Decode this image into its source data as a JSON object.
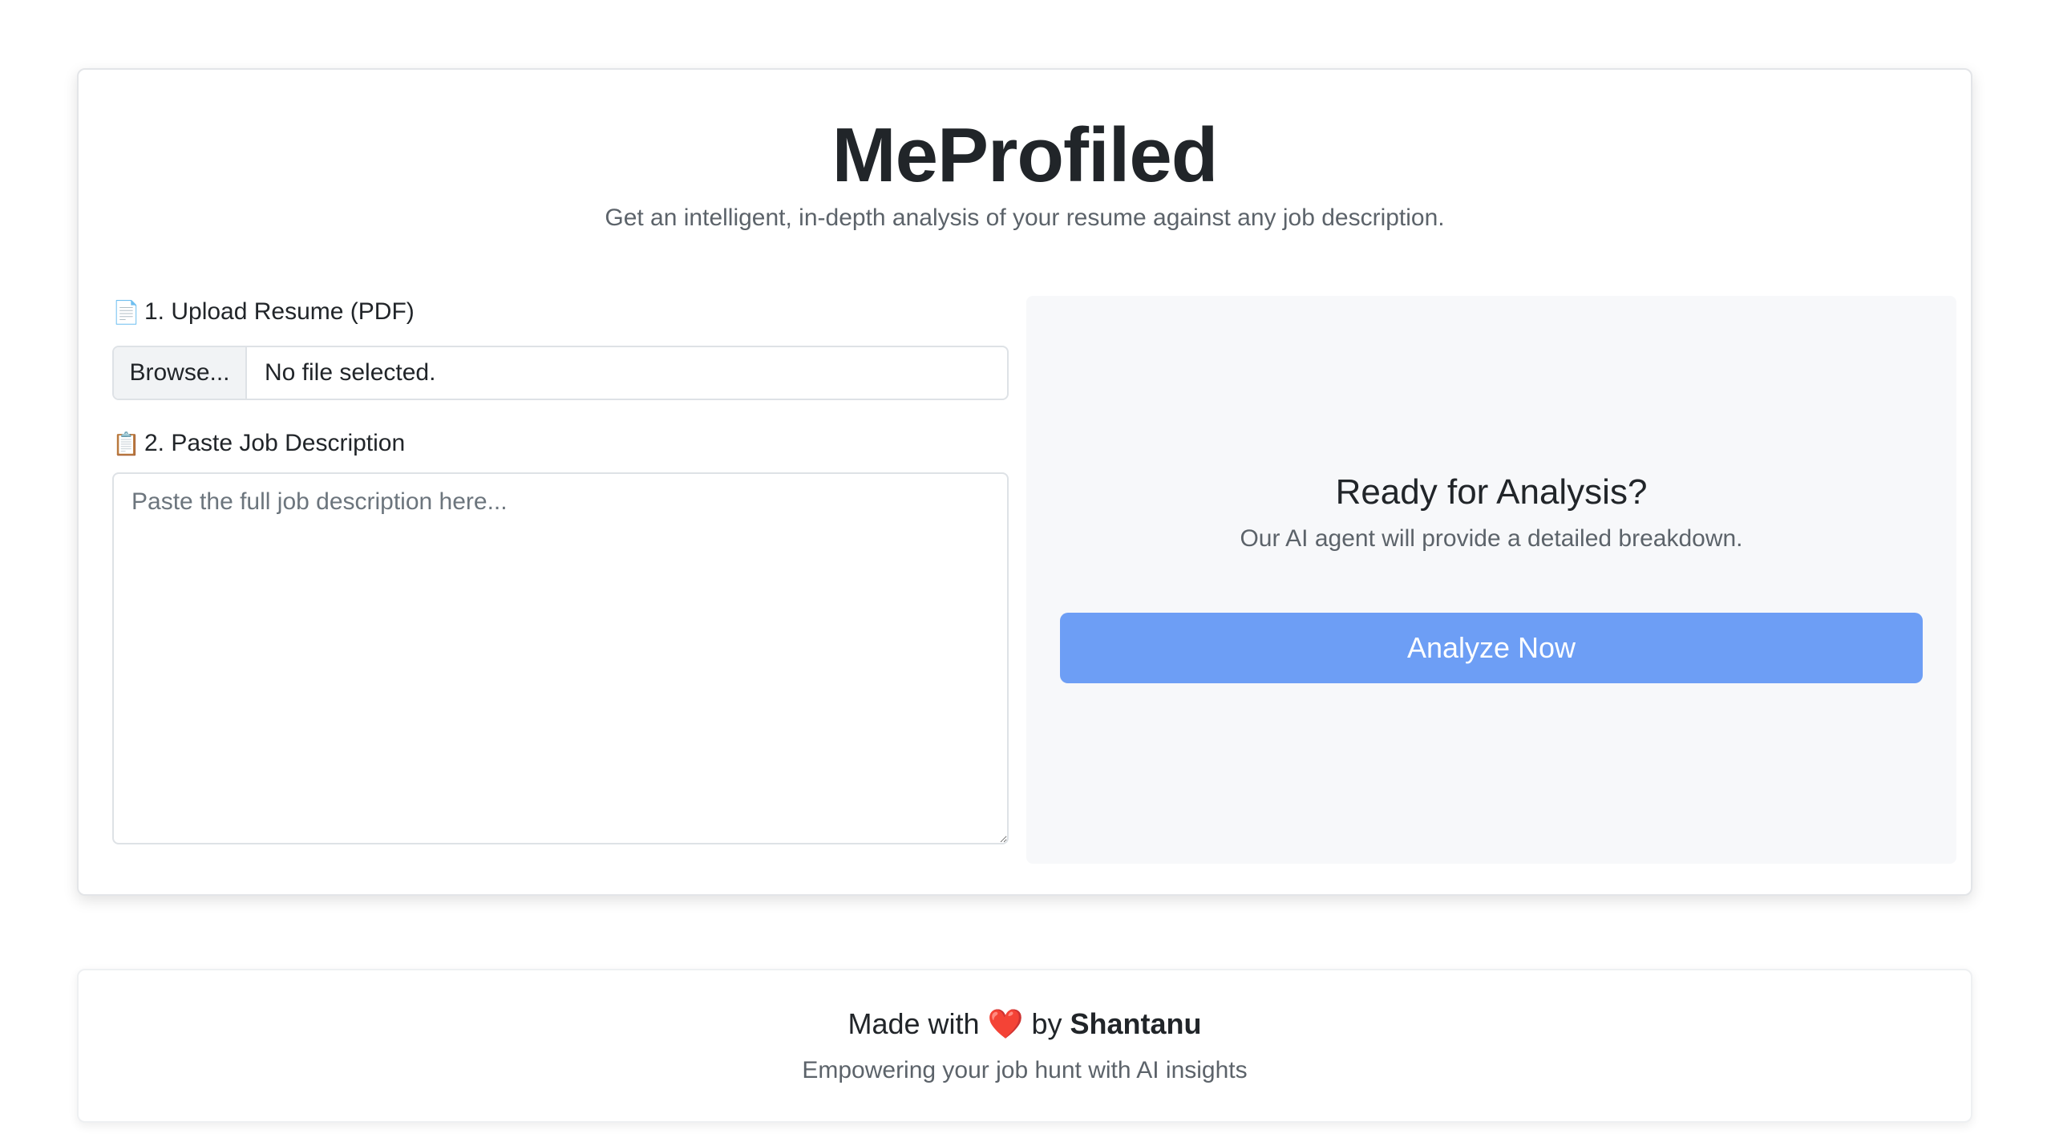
{
  "app": {
    "title": "MeProfiled",
    "subtitle": "Get an intelligent, in-depth analysis of your resume against any job description."
  },
  "upload": {
    "icon": "📄",
    "label": "1. Upload Resume (PDF)",
    "browse_label": "Browse...",
    "file_status": "No file selected."
  },
  "job_description": {
    "icon": "📋",
    "label": "2. Paste Job Description",
    "placeholder": "Paste the full job description here...",
    "value": ""
  },
  "analysis_panel": {
    "title": "Ready for Analysis?",
    "description": "Our AI agent will provide a detailed breakdown.",
    "button_label": "Analyze Now",
    "button_color": "#6d9ef5"
  },
  "footer": {
    "made_with": "Made with",
    "heart": "❤️",
    "by": "by",
    "author": "Shantanu",
    "tagline": "Empowering your job hunt with AI insights"
  }
}
